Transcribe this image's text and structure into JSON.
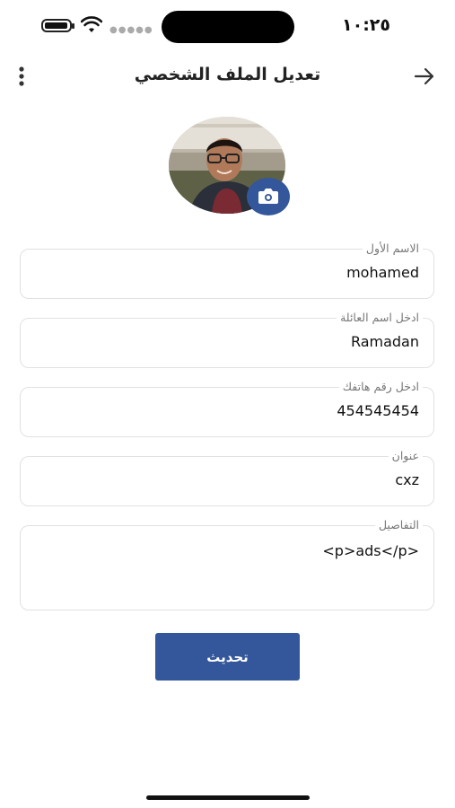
{
  "status_bar": {
    "time": "١٠:٢٥",
    "battery_level": 0.82
  },
  "header": {
    "title": "تعديل الملف الشخصي",
    "back_icon": "arrow-right-icon",
    "menu_icon": "more-vertical-icon"
  },
  "avatar": {
    "camera_icon": "camera-icon",
    "accent": "#33579a"
  },
  "form": {
    "first_name": {
      "label": "الاسم الأول",
      "value": "mohamed"
    },
    "last_name": {
      "label": "ادخل اسم العائلة",
      "value": "Ramadan"
    },
    "phone": {
      "label": "ادخل رقم هاتفك",
      "value": "454545454"
    },
    "address": {
      "label": "عنوان",
      "value": "cxz"
    },
    "details": {
      "label": "التفاصيل",
      "value": "<p>ads</p>"
    }
  },
  "update_button": {
    "label": "تحديث"
  }
}
